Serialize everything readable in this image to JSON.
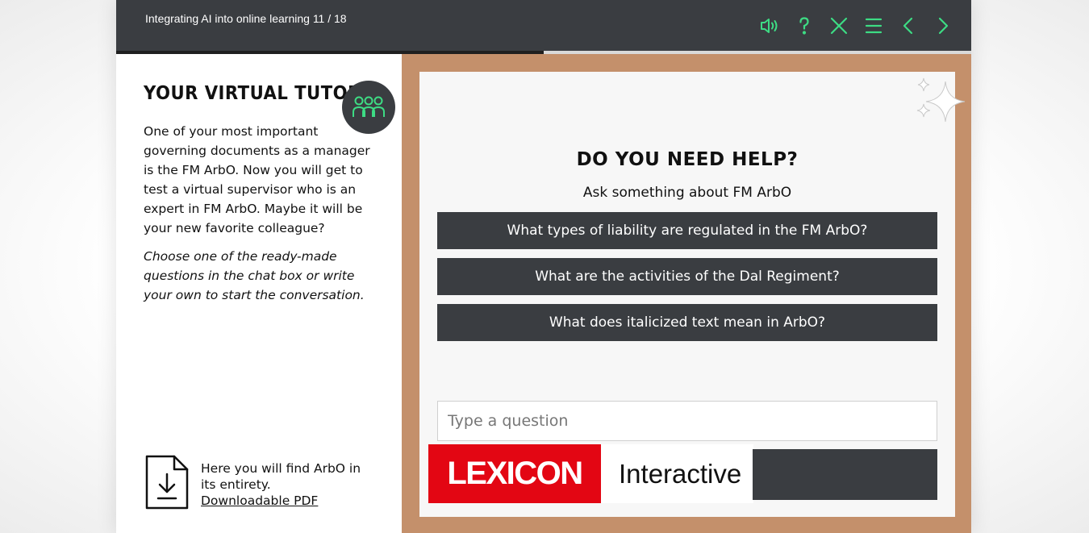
{
  "header": {
    "course_title": "Integrating AI into online learning 11 / 18",
    "progress_fraction": 0.5,
    "toolbar_icons": [
      "speaker-icon",
      "help-icon",
      "close-icon",
      "menu-icon",
      "previous-icon",
      "next-icon"
    ]
  },
  "left": {
    "title": "YOUR VIRTUAL TUTOR",
    "badge_icon": "people-icon",
    "intro": "One of your most important governing documents as a manager is the FM ArbO. Now you will get to test a virtual supervisor who is an expert in FM ArbO. Maybe it will be your new favorite colleague?",
    "instruction": "Choose one of the ready-made questions in the chat box or write your own to start the conversation.",
    "pdf": {
      "icon": "download-document-icon",
      "text": "Here you will find ArbO in its entirety.",
      "link": "Downloadable PDF"
    }
  },
  "chat": {
    "title": "DO YOU NEED HELP?",
    "subtitle": "Ask something about FM ArbO",
    "questions": [
      "What types of liability are regulated in the FM ArbO?",
      "What are the activities of the Dal Regiment?",
      "What does italicized text mean in ArbO?"
    ],
    "input_placeholder": "Type a question",
    "input_value": "",
    "brand_primary": "LEXICON",
    "brand_secondary": "Interactive"
  },
  "colors": {
    "topbar": "#3a3d41",
    "accent_green": "#3ddc84",
    "panel_tan": "#c4906b",
    "brand_red": "#e30613"
  }
}
